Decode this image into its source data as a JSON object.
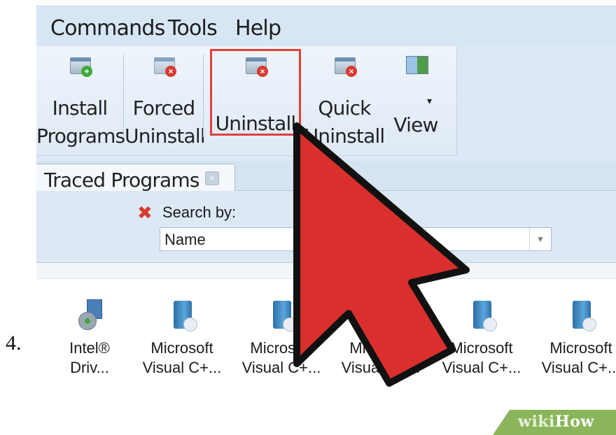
{
  "step": {
    "number": "4."
  },
  "menu": {
    "items": [
      "Commands",
      "Tools",
      "Help"
    ]
  },
  "ribbon": {
    "install_line1": "Install",
    "install_line2": "Programs",
    "forced_line1": "Forced",
    "forced_line2": "Uninstall",
    "uninstall": "Uninstall",
    "quick_line1": "Quick",
    "quick_line2": "Uninstall",
    "view": "View",
    "view_dropdown_glyph": "▾"
  },
  "tab": {
    "label": "Traced Programs"
  },
  "search": {
    "clear_glyph": "✖",
    "label": "Search by:",
    "selected": "Name"
  },
  "programs": [
    {
      "line1": "Intel®",
      "line2": "Driv..."
    },
    {
      "line1": "Microsoft",
      "line2": "Visual C+..."
    },
    {
      "line1": "Microsoft",
      "line2": "Visual C+..."
    },
    {
      "line1": "Microsoft",
      "line2": "Visual C+..."
    },
    {
      "line1": "Microsoft",
      "line2": "Visual C+..."
    },
    {
      "line1": "Microsoft",
      "line2": "Visual C+..."
    }
  ],
  "brand": {
    "wiki": "wiki",
    "how": "How"
  },
  "colors": {
    "highlight": "#e0403a",
    "cursor": "#d9302e",
    "brand": "#8ab55b"
  }
}
